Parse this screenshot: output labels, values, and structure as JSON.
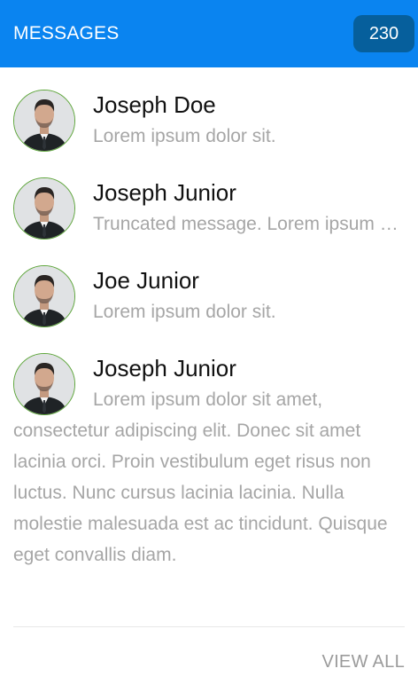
{
  "header": {
    "title": "MESSAGES",
    "count": "230"
  },
  "messages": [
    {
      "name": "Joseph Doe",
      "text": "Lorem ipsum dolor sit.",
      "avatar_icon": "user-avatar-icon"
    },
    {
      "name": "Joseph Junior",
      "text": "Truncated message. Lorem ipsum dolor sit amet, consectetur adipiscing elit.",
      "avatar_icon": "user-avatar-icon"
    },
    {
      "name": "Joe Junior",
      "text": "Lorem ipsum dolor sit.",
      "avatar_icon": "user-avatar-icon"
    },
    {
      "name": "Joseph Junior",
      "text": "Lorem ipsum dolor sit amet, consectetur adipiscing elit. Donec sit amet lacinia orci. Proin vestibulum eget risus non luctus. Nunc cursus lacinia lacinia. Nulla molestie malesuada est ac tincidunt. Quisque eget convallis diam.",
      "avatar_icon": "user-avatar-icon"
    }
  ],
  "footer": {
    "view_all_label": "VIEW ALL"
  },
  "colors": {
    "header_bg": "#0a84f0",
    "badge_bg": "#065f9c",
    "avatar_border": "#5ea63b",
    "muted_text": "#a6a6a6"
  }
}
